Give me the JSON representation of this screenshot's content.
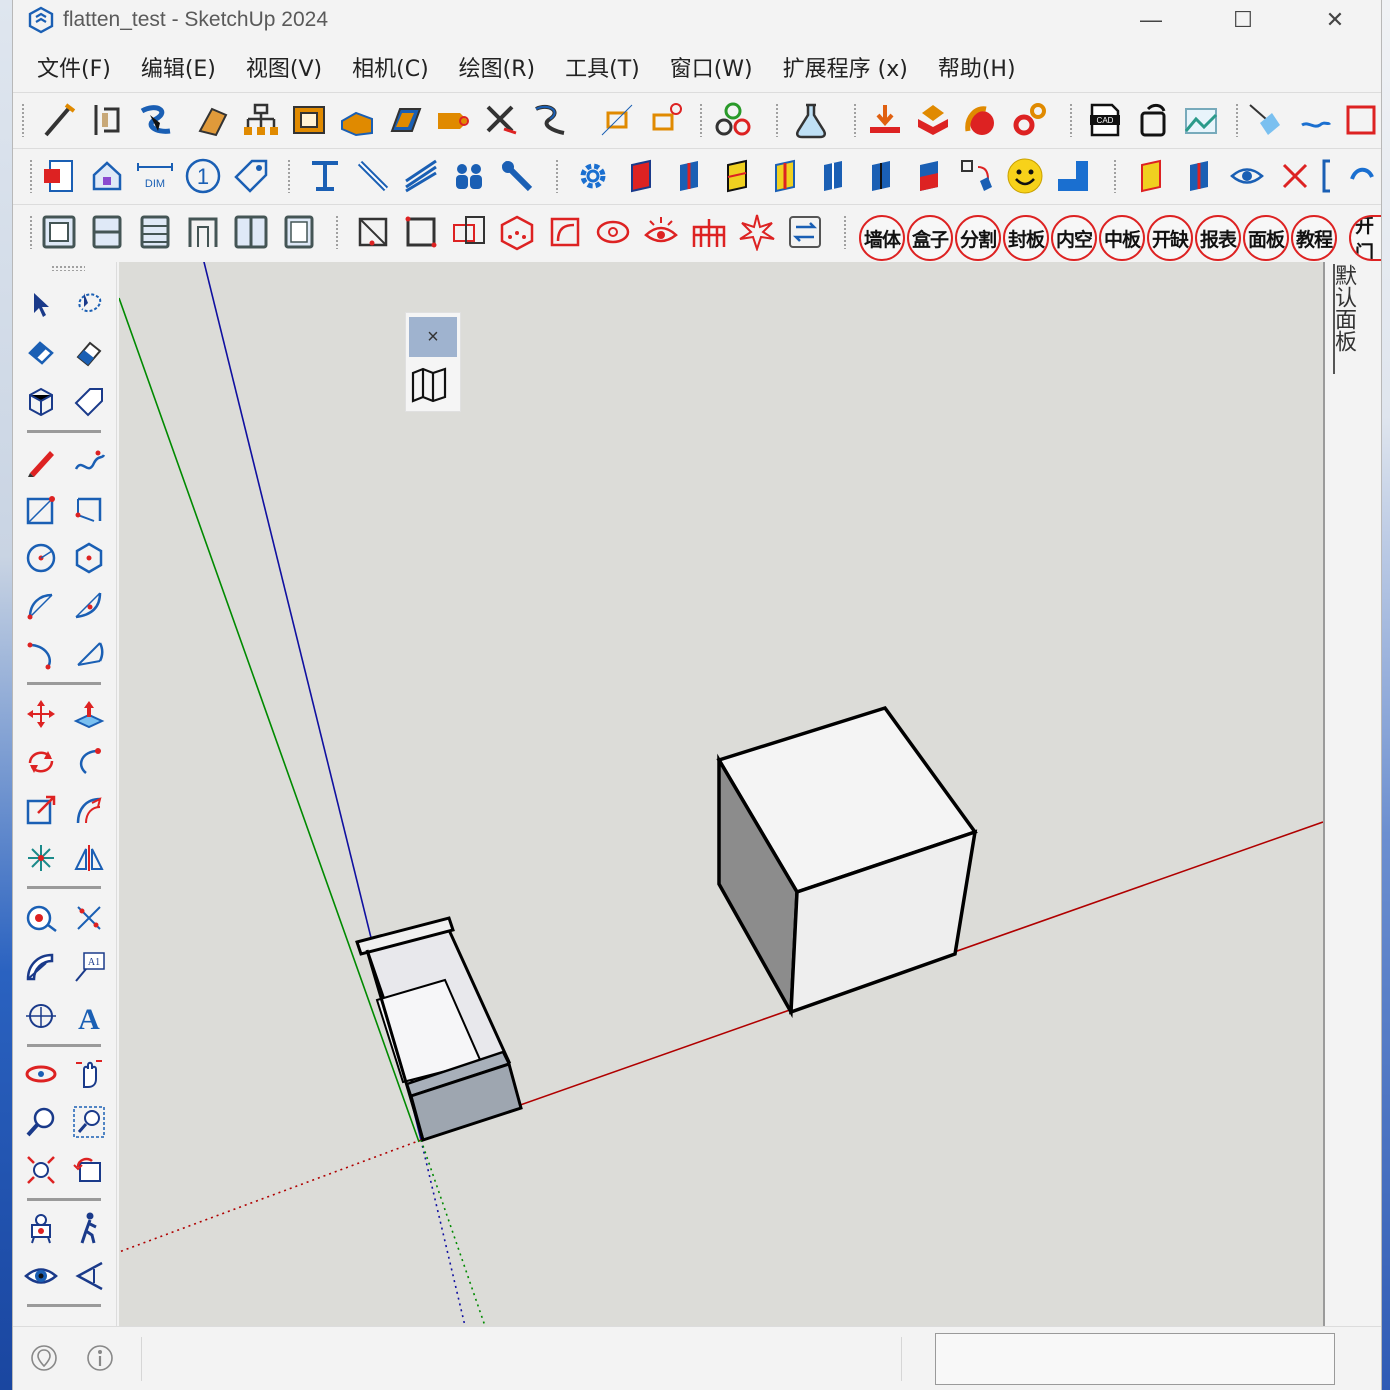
{
  "window": {
    "title": "flatten_test - SketchUp 2024",
    "minimize": "—",
    "maximize": "☐",
    "close": "✕"
  },
  "menu": [
    "文件(F)",
    "编辑(E)",
    "视图(V)",
    "相机(C)",
    "绘图(R)",
    "工具(T)",
    "窗口(W)",
    "扩展程序 (x)",
    "帮助(H)"
  ],
  "toolbar_row3_cn_buttons": [
    "墙体",
    "盒子",
    "分割",
    "封板",
    "内空",
    "中板",
    "开缺",
    "报表",
    "面板",
    "教程",
    "开门"
  ],
  "toolbar_icons": {
    "dim_label": "DIM",
    "cad_label": "CAD",
    "circle_one": "1"
  },
  "floating_panel": {
    "close": "×"
  },
  "right_panel": {
    "tab_label": "默认面板"
  },
  "palette": {
    "text_tool_glyph": "A",
    "label_tool_glyph": "A1"
  },
  "colors": {
    "axis_red": "#c00000",
    "axis_green": "#008a00",
    "axis_blue": "#1010a0",
    "accent_red": "#d22222",
    "accent_blue": "#1a6fd0"
  }
}
